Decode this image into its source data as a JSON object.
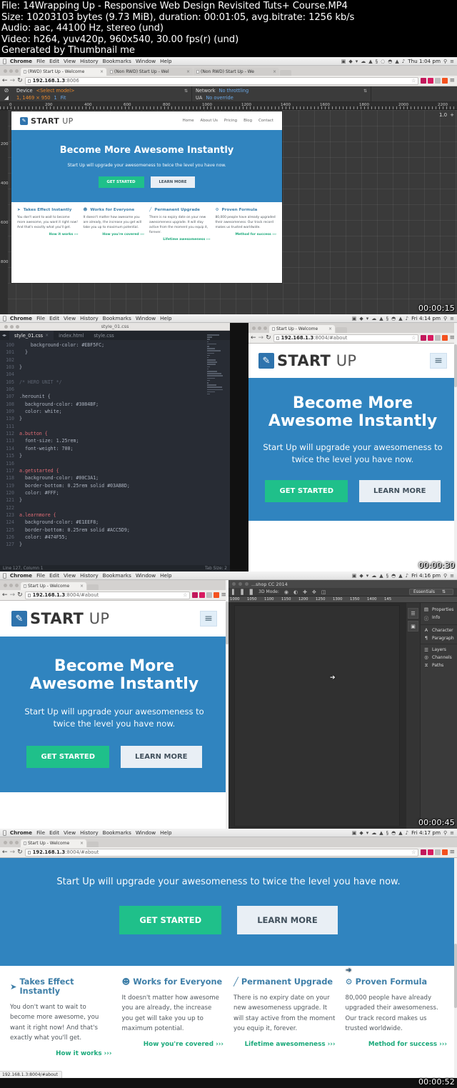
{
  "meta": {
    "file": "File: 14Wrapping Up - Responsive Web Design Revisited Tuts+ Course.MP4",
    "size": "Size: 10203103 bytes (9.73 MiB), duration: 00:01:05, avg.bitrate: 1256 kb/s",
    "audio": "Audio: aac, 44100 Hz, stereo (und)",
    "video": "Video: h264, yuv420p, 960x540, 30.00 fps(r) (und)",
    "generator": "Generated by Thumbnail me"
  },
  "macbar": {
    "apple": "apple-icon",
    "items": [
      "Chrome",
      "File",
      "Edit",
      "View",
      "History",
      "Bookmarks",
      "Window",
      "Help"
    ],
    "right_icons": [
      "screen-record-icon",
      "dropbox-icon",
      "bittorrent-icon",
      "cloud-icon",
      "alarm-icon",
      "skitch-icon",
      "bluetooth-icon",
      "timemachine-icon",
      "battery-icon",
      "wifi-icon",
      "eject-icon",
      "volume-icon"
    ],
    "clock_frame1": "Thu 1:04 pm",
    "clock_frame2": "Fri 4:14 pm",
    "clock_frame3": "Fri 4:16 pm",
    "clock_frame4": "Fri 4:17 pm",
    "search_icon": "search-icon",
    "menu_icon": "list-icon"
  },
  "frames": [
    {
      "timestamp": "00:00:15"
    },
    {
      "timestamp": "00:00:30"
    },
    {
      "timestamp": "00:00:45"
    },
    {
      "timestamp": "00:00:52"
    }
  ],
  "frame1": {
    "tabs": [
      {
        "label": "(RWD) Start Up - Welcome",
        "active": true
      },
      {
        "label": "(Non RWD) Start Up - Wel",
        "active": false
      },
      {
        "label": "(Non RWD) Start Up - We",
        "active": false
      }
    ],
    "url_host": "192.168.1.3",
    "url_port": ":8006",
    "devtools": {
      "device_label": "Device",
      "device_value": "<Select model>",
      "network_label": "Network",
      "network_value": "No throttling",
      "ua_label": "UA",
      "ua_value": "No override",
      "dimensions": "1, 1469 × 950",
      "dpr": "1",
      "fit_label": "Fit"
    },
    "ruler_ticks": [
      "0",
      "200",
      "400",
      "600",
      "800",
      "1000",
      "1200",
      "1400",
      "1600",
      "1800",
      "2000",
      "2200",
      "24"
    ],
    "vruler_ticks": [
      "200",
      "400",
      "600",
      "800"
    ],
    "zoom_level": "1.0"
  },
  "frame2": {
    "editor": {
      "window_title": "style_01.css",
      "tabs": [
        {
          "label": "style_01.css",
          "active": true
        },
        {
          "label": "index.html",
          "active": false
        },
        {
          "label": "style.css",
          "active": false
        }
      ],
      "status_left": "Line 127, Column 1",
      "status_right": "Tab Size: 2",
      "lines": [
        {
          "n": "100",
          "t": "    background-color: #EBF5FC;"
        },
        {
          "n": "101",
          "t": "  }"
        },
        {
          "n": "102",
          "t": ""
        },
        {
          "n": "103",
          "t": "}"
        },
        {
          "n": "104",
          "t": ""
        },
        {
          "n": "105",
          "t": "/* HERO UNIT */"
        },
        {
          "n": "106",
          "t": ""
        },
        {
          "n": "107",
          "t": ".herounit {"
        },
        {
          "n": "108",
          "t": "  background-color: #3084BF;"
        },
        {
          "n": "109",
          "t": "  color: white;"
        },
        {
          "n": "110",
          "t": "}"
        },
        {
          "n": "111",
          "t": ""
        },
        {
          "n": "112",
          "t": "a.button {"
        },
        {
          "n": "113",
          "t": "  font-size: 1.25rem;"
        },
        {
          "n": "114",
          "t": "  font-weight: 700;"
        },
        {
          "n": "115",
          "t": "}"
        },
        {
          "n": "116",
          "t": ""
        },
        {
          "n": "117",
          "t": "a.getstarted {"
        },
        {
          "n": "118",
          "t": "  background-color: #00C3A1;"
        },
        {
          "n": "119",
          "t": "  border-bottom: 0.25rem solid #03AB8D;"
        },
        {
          "n": "120",
          "t": "  color: #FFF;"
        },
        {
          "n": "121",
          "t": "}"
        },
        {
          "n": "122",
          "t": ""
        },
        {
          "n": "123",
          "t": "a.learnmore {"
        },
        {
          "n": "124",
          "t": "  background-color: #E1EEF8;"
        },
        {
          "n": "125",
          "t": "  border-bottom: 0.25rem solid #ACC5D9;"
        },
        {
          "n": "126",
          "t": "  color: #474F55;"
        },
        {
          "n": "127",
          "t": "}"
        }
      ]
    },
    "browser": {
      "tab_label": "Start Up - Welcome",
      "url_host": "192.168.1.3",
      "url_rest": ":8004/#about"
    }
  },
  "frame3": {
    "browser": {
      "tab_label": "Start Up - Welcome",
      "url_host": "192.168.1.3",
      "url_rest": ":8004/#about"
    },
    "photoshop": {
      "title": "...shop CC 2014",
      "mode_label": "3D Mode:",
      "workspace": "Essentials",
      "ruler_ticks": [
        "1000",
        "1050",
        "1100",
        "1150",
        "1200",
        "1250",
        "1300",
        "1350",
        "1400",
        "145"
      ],
      "panel_groups": [
        [
          {
            "icon": "properties-icon",
            "name": "Properties"
          },
          {
            "icon": "info-icon",
            "name": "Info"
          }
        ],
        [
          {
            "icon": "character-icon",
            "name": "Character"
          },
          {
            "icon": "paragraph-icon",
            "name": "Paragraph"
          }
        ],
        [
          {
            "icon": "layers-icon",
            "name": "Layers"
          },
          {
            "icon": "channels-icon",
            "name": "Channels"
          },
          {
            "icon": "paths-icon",
            "name": "Paths"
          }
        ]
      ]
    }
  },
  "frame4": {
    "browser": {
      "tab_label": "Start Up - Welcome",
      "url_host": "192.168.1.3",
      "url_rest": ":8004/#about"
    },
    "status_bubble": "192.168.1.3:8004/#about"
  },
  "site": {
    "brand_bold": "START",
    "brand_light": "UP",
    "logo_icon": "pencil-square-icon",
    "nav_links": [
      "Home",
      "About Us",
      "Pricing",
      "Blog",
      "Contact"
    ],
    "burger_icon": "hamburger-icon",
    "hero_title": "Become More Awesome Instantly",
    "hero_sub": "Start Up will upgrade your awesomeness to twice the level you have now.",
    "btn_get_started": "GET STARTED",
    "btn_learn_more": "LEARN MORE",
    "features": [
      {
        "icon": "rocket-icon",
        "title": "Takes Effect Instantly",
        "body": "You don't want to wait to become more awesome, you want it right now! And that's exactly what you'll get.",
        "link": "How it works ›››"
      },
      {
        "icon": "people-icon",
        "title": "Works for Everyone",
        "body": "It doesn't matter how awesome you are already, the increase you get will take you up to maximum potential.",
        "link": "How you're covered ›››"
      },
      {
        "icon": "chart-icon",
        "title": "Permanent Upgrade",
        "body": "There is no expiry date on your new awesomeness upgrade. It will stay active from the moment you equip it, forever.",
        "link": "Lifetime awesomeness ›››"
      },
      {
        "icon": "gears-icon",
        "title": "Proven Formula",
        "body": "80,000 people have already upgraded their awesomeness. Our track record makes us trusted worldwide.",
        "link": "Method for success ›››"
      }
    ]
  },
  "colors": {
    "hero_blue": "#3084bf",
    "green": "#1fc08a",
    "link_green": "#1aa97a",
    "feature_title": "#3f7fa8",
    "learn_bg": "#e9eff5"
  }
}
